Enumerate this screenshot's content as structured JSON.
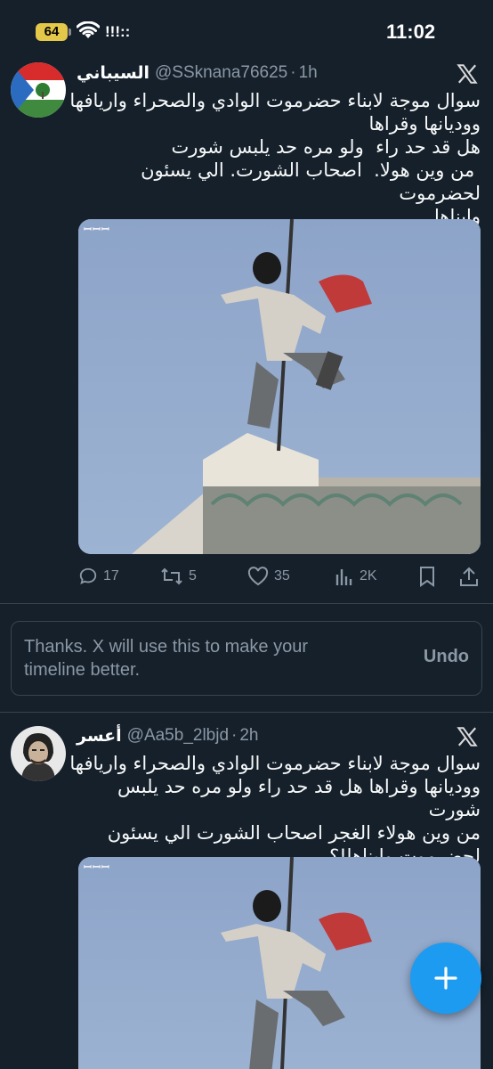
{
  "status_bar": {
    "time": "11:02",
    "battery": "64",
    "signal": "!!!::"
  },
  "tweets": [
    {
      "author": "السيباني",
      "handle": "@SSknana76625",
      "time": "1h",
      "text": "سوال موجة لابناء حضرموت الوادي والصحراء واريافها\nووديانها وقراها\nهل قد حد راء  ولو مره حد يلبس شورت\n من وين هولا.  اصحاب الشورت. الي يسئون لحضرموت\nوابناها",
      "media_badge": "ꟷꟷꟷ",
      "stats": {
        "replies": "17",
        "reposts": "5",
        "likes": "35",
        "views": "2K"
      }
    },
    {
      "author": "أعسر",
      "handle": "@Aa5b_2lbjd",
      "time": "2h",
      "text": "سوال موجة لابناء حضرموت الوادي والصحراء واريافها\nووديانها وقراها هل قد حد راء ولو مره حد يلبس شورت\nمن وين هولاء الغجر اصحاب الشورت الي يسئون\nلحضرموت وابناها!؟",
      "media_badge": "ꟷꟷꟷ"
    }
  ],
  "feedback": {
    "message": "Thanks. X will use this to make your timeline better.",
    "undo_label": "Undo"
  },
  "colors": {
    "background": "#15202b",
    "accent": "#1d9bf0",
    "muted": "#8b98a5"
  }
}
